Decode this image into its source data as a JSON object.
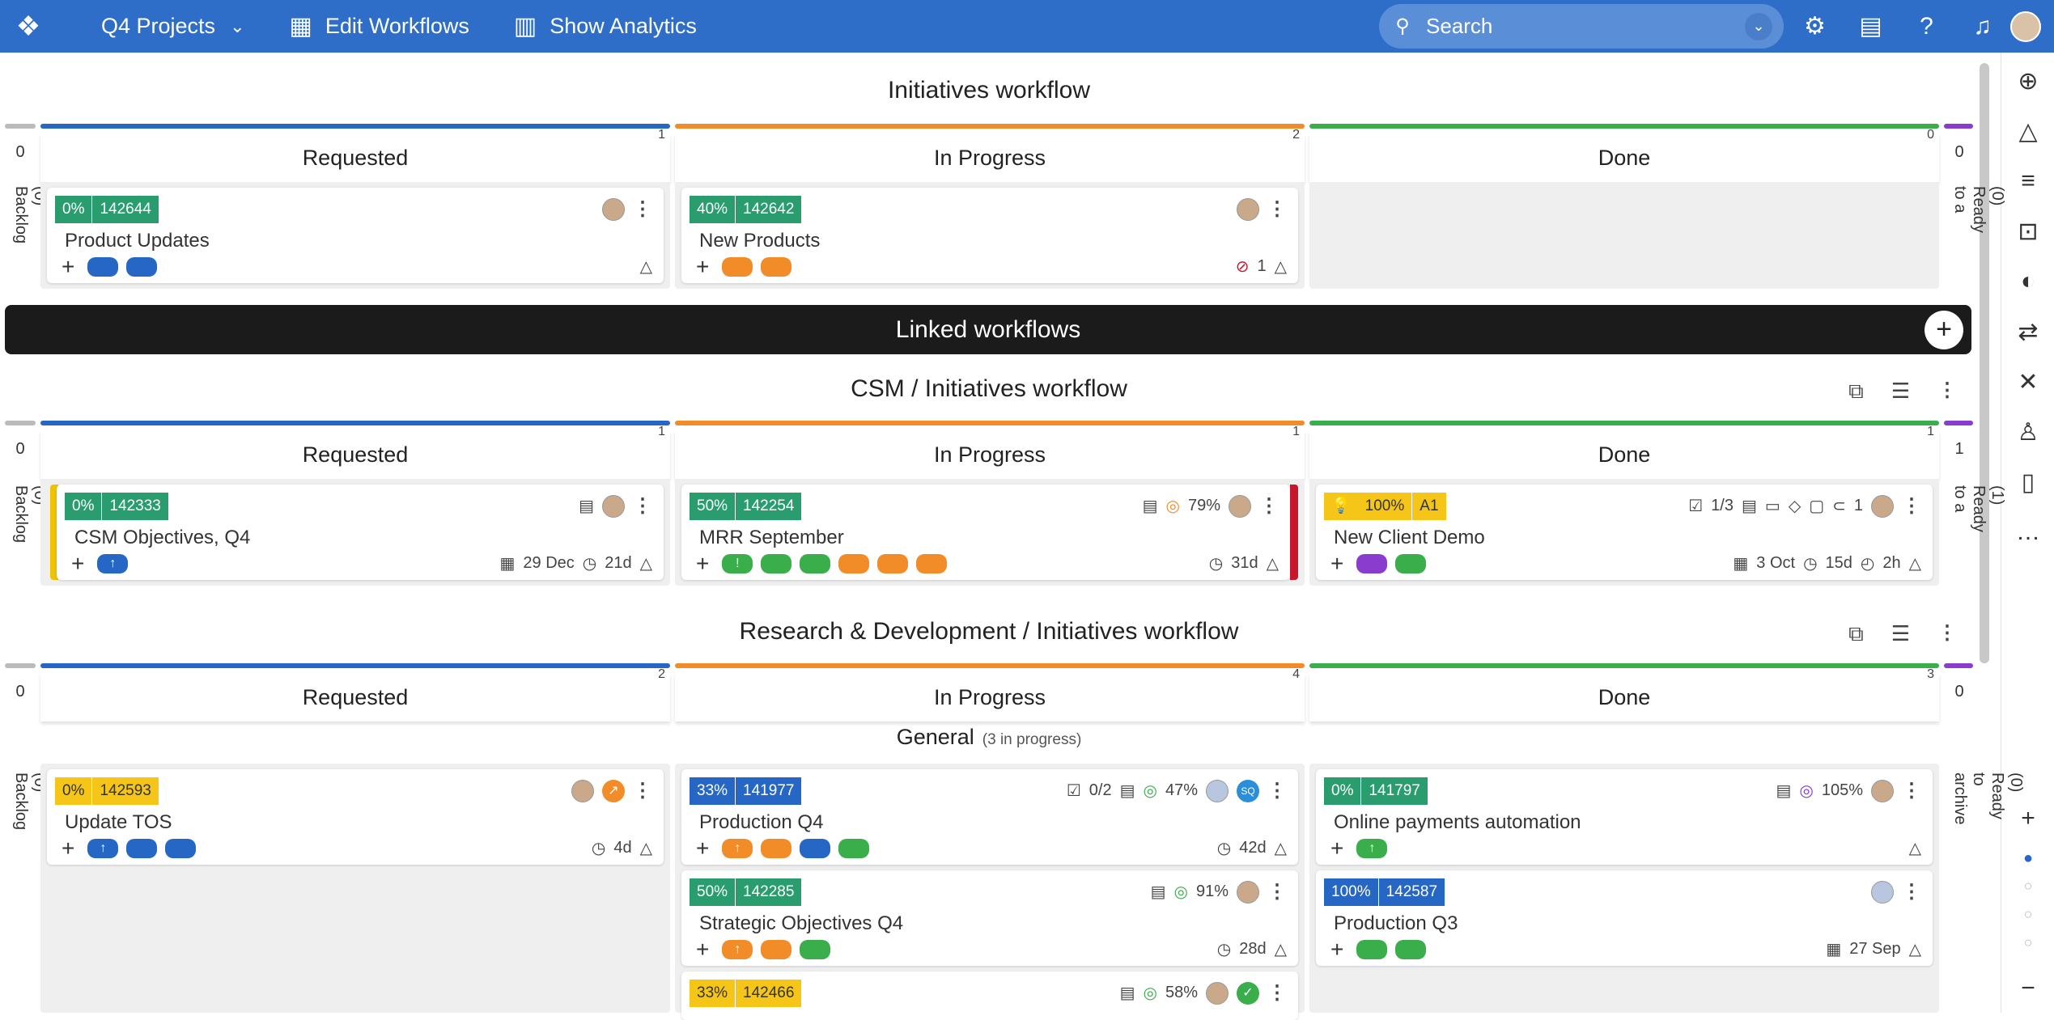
{
  "topbar": {
    "project": "Q4 Projects",
    "edit_workflows": "Edit Workflows",
    "show_analytics": "Show Analytics",
    "search_placeholder": "Search"
  },
  "colors": {
    "blue": "#2666c4",
    "orange": "#f28c28",
    "green": "#3aae4a",
    "purple": "#8a3ccf",
    "yellow": "#f5c518",
    "teal": "#2a9d6f",
    "red": "#c6172c"
  },
  "main_workflow": {
    "title": "Initiatives workflow",
    "left_count": "0",
    "left_label": "(0) Backlog",
    "right_count": "0",
    "right_label": "(0) Ready to a",
    "columns": [
      {
        "name": "Requested",
        "count": "1"
      },
      {
        "name": "In Progress",
        "count": "2"
      },
      {
        "name": "Done",
        "count": "0"
      }
    ],
    "cards": [
      {
        "pct": "0%",
        "id": "142644",
        "title": "Product Updates"
      },
      {
        "pct": "40%",
        "id": "142642",
        "title": "New Products",
        "blocked": "1"
      }
    ]
  },
  "linked": {
    "title": "Linked workflows"
  },
  "csm": {
    "title": "CSM / Initiatives workflow",
    "left_count": "0",
    "left_label": "(0) Backlog",
    "right_count": "1",
    "right_label": "(1) Ready to a",
    "columns": [
      {
        "name": "Requested",
        "count": "1"
      },
      {
        "name": "In Progress",
        "count": "1"
      },
      {
        "name": "Done",
        "count": "1"
      }
    ],
    "cards": [
      {
        "pct": "0%",
        "id": "142333",
        "title": "CSM Objectives, Q4",
        "date": "29 Dec",
        "time": "21d"
      },
      {
        "pct": "50%",
        "id": "142254",
        "title": "MRR September",
        "progress": "79%",
        "time": "31d"
      },
      {
        "pct": "100%",
        "id": "A1",
        "title": "New Client Demo",
        "checklist": "1/3",
        "attach": "1",
        "date": "3 Oct",
        "time": "15d",
        "hours": "2h"
      }
    ]
  },
  "rnd": {
    "title": "Research & Development / Initiatives workflow",
    "left_count": "0",
    "left_label": "(0) Backlog",
    "right_count": "0",
    "right_label": "(0) Ready to archive",
    "columns": [
      {
        "name": "Requested",
        "count": "2"
      },
      {
        "name": "In Progress",
        "count": "4"
      },
      {
        "name": "Done",
        "count": "3"
      }
    ],
    "group": {
      "name": "General",
      "note": "(3 in progress)"
    },
    "cards": [
      {
        "pct": "0%",
        "id": "142593",
        "title": "Update TOS",
        "time": "4d"
      },
      {
        "pct": "33%",
        "id": "141977",
        "title": "Production Q4",
        "checklist": "0/2",
        "progress": "47%",
        "initials": "SQ",
        "time": "42d"
      },
      {
        "pct": "50%",
        "id": "142285",
        "title": "Strategic Objectives Q4",
        "progress": "91%",
        "time": "28d"
      },
      {
        "pct": "33%",
        "id": "142466",
        "progress": "58%"
      },
      {
        "pct": "0%",
        "id": "141797",
        "title": "Online payments automation",
        "progress": "105%"
      },
      {
        "pct": "100%",
        "id": "142587",
        "title": "Production Q3",
        "date": "27 Sep"
      }
    ]
  }
}
